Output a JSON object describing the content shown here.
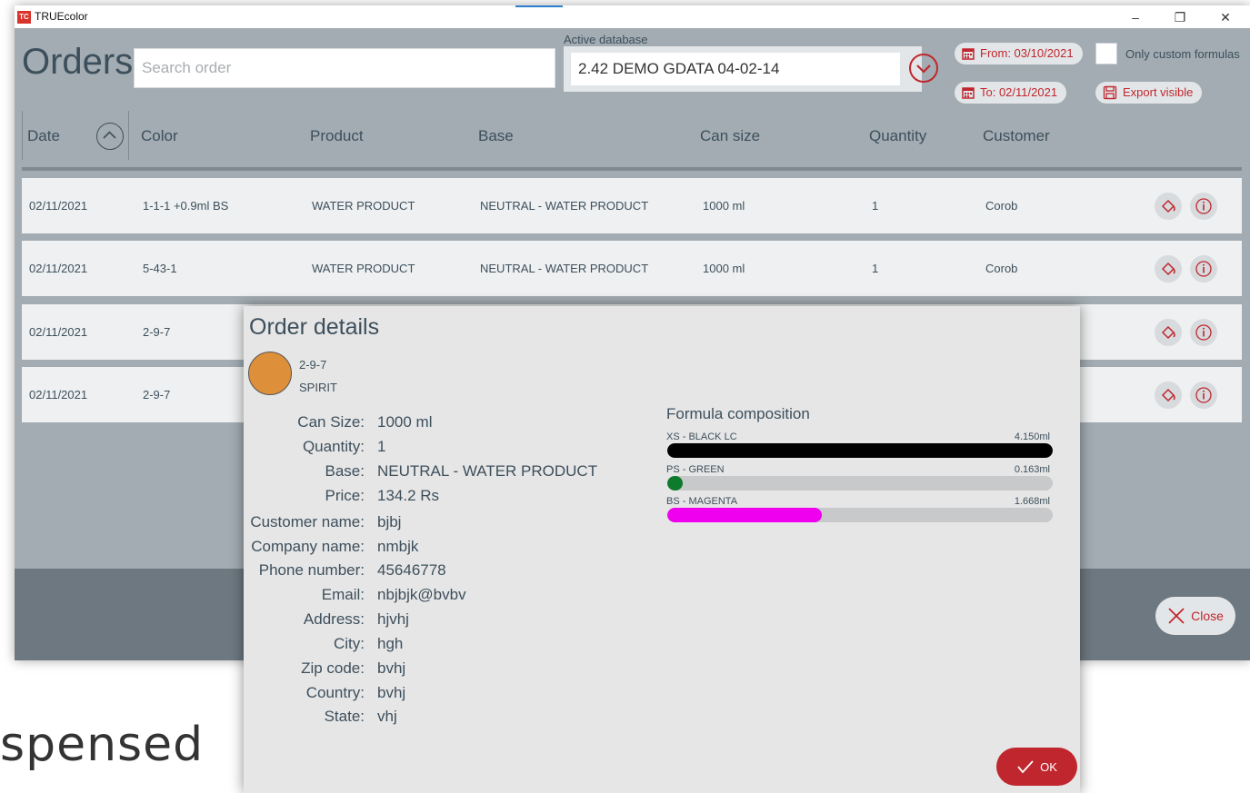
{
  "background_text": "spensed",
  "window": {
    "title": "TRUEcolor",
    "icon_label": "TC",
    "controls": [
      "–",
      "❐",
      "✕"
    ]
  },
  "header": {
    "title": "Orders",
    "search_placeholder": "Search order",
    "active_db_label": "Active database",
    "active_db_value": "2.42  DEMO GDATA 04-02-14",
    "from_date": "From: 03/10/2021",
    "to_date": "To: 02/11/2021",
    "only_custom_label": "Only custom formulas",
    "export_label": "Export visible"
  },
  "columns": [
    "Date",
    "Color",
    "Product",
    "Base",
    "Can size",
    "Quantity",
    "Customer"
  ],
  "rows": [
    {
      "date": "02/11/2021",
      "color": "1-1-1 +0.9ml BS",
      "product": "WATER PRODUCT",
      "base": "NEUTRAL - WATER PRODUCT",
      "can": "1000 ml",
      "qty": "1",
      "customer": "Corob"
    },
    {
      "date": "02/11/2021",
      "color": "5-43-1",
      "product": "WATER PRODUCT",
      "base": "NEUTRAL - WATER PRODUCT",
      "can": "1000 ml",
      "qty": "1",
      "customer": "Corob"
    },
    {
      "date": "02/11/2021",
      "color": "2-9-7"
    },
    {
      "date": "02/11/2021",
      "color": "2-9-7"
    }
  ],
  "footer": {
    "close_label": "Close"
  },
  "dialog": {
    "title": "Order details",
    "swatch_color": "#dd8f3a",
    "color_code": "2-9-7",
    "product": "SPIRIT",
    "fields": [
      {
        "label": "Can Size:",
        "value": "1000 ml"
      },
      {
        "label": "Quantity:",
        "value": "1"
      },
      {
        "label": "Base:",
        "value": "NEUTRAL - WATER PRODUCT"
      },
      {
        "label": "Price:",
        "value": "134.2 Rs"
      },
      {
        "label": "Customer name:",
        "value": "bjbj"
      },
      {
        "label": "Company name:",
        "value": "nmbjk"
      },
      {
        "label": "Phone number:",
        "value": "45646778"
      },
      {
        "label": "Email:",
        "value": "nbjbjk@bvbv"
      },
      {
        "label": "Address:",
        "value": "hjvhj"
      },
      {
        "label": "City:",
        "value": "hgh"
      },
      {
        "label": "Zip code:",
        "value": "bvhj"
      },
      {
        "label": "Country:",
        "value": "bvhj"
      },
      {
        "label": "State:",
        "value": "vhj"
      }
    ],
    "formula_title": "Formula composition",
    "formula": [
      {
        "name": "XS - BLACK LC",
        "amount": "4.150ml",
        "color": "#000000",
        "fill": 1.0
      },
      {
        "name": "PS - GREEN",
        "amount": "0.163ml",
        "color": "#0e7a2c",
        "fill": 0.04
      },
      {
        "name": "BS - MAGENTA",
        "amount": "1.668ml",
        "color": "#ef00ef",
        "fill": 0.4
      }
    ],
    "ok_label": "OK"
  }
}
